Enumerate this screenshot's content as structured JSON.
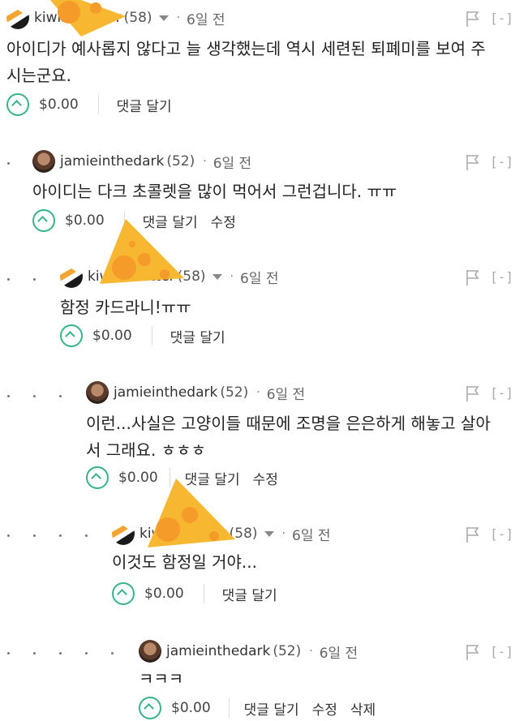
{
  "comments": [
    {
      "author": "kiwisweetter",
      "rep": "(58)",
      "time": "6일 전",
      "body": [
        "아이디가 예사롭지 않다고 늘 생각했는데 역시 세련된 퇴폐미를 보여 주",
        "시는군요."
      ],
      "payout": "$0.00",
      "actions": [
        "댓글 달기"
      ]
    },
    {
      "author": "jamieinthedark",
      "rep": "(52)",
      "time": "6일 전",
      "body": [
        "아이디는 다크 초콜렛을 많이 먹어서 그런겁니다. ㅠㅠ"
      ],
      "payout": "$0.00",
      "actions": [
        "댓글 달기",
        "수정"
      ]
    },
    {
      "author": "kiwisweetter",
      "rep": "(58)",
      "time": "6일 전",
      "body": [
        "함정 카드라니!ㅠㅠ"
      ],
      "payout": "$0.00",
      "actions": [
        "댓글 달기"
      ]
    },
    {
      "author": "jamieinthedark",
      "rep": "(52)",
      "time": "6일 전",
      "body": [
        "이런...사실은 고양이들 때문에 조명을 은은하게 해놓고 살아",
        "서 그래요. ㅎㅎㅎ"
      ],
      "payout": "$0.00",
      "actions": [
        "댓글 달기",
        "수정"
      ]
    },
    {
      "author": "kiwisweetter",
      "rep": "(58)",
      "time": "6일 전",
      "body": [
        "이것도 함정일 거야..."
      ],
      "payout": "$0.00",
      "actions": [
        "댓글 달기"
      ]
    },
    {
      "author": "jamieinthedark",
      "rep": "(52)",
      "time": "6일 전",
      "body": [
        "ㅋㅋㅋ"
      ],
      "payout": "$0.00",
      "actions": [
        "댓글 달기",
        "수정",
        "삭제"
      ]
    }
  ],
  "ui": {
    "separator": "·",
    "collapse_label": "[-]"
  },
  "icons": {
    "flag": "flag-icon",
    "upvote": "upvote-icon",
    "caret": "chevron-down-icon",
    "sticker": "cheese-sticker"
  },
  "colors": {
    "accent": "#36b38a",
    "cheese": "#f7b731"
  }
}
